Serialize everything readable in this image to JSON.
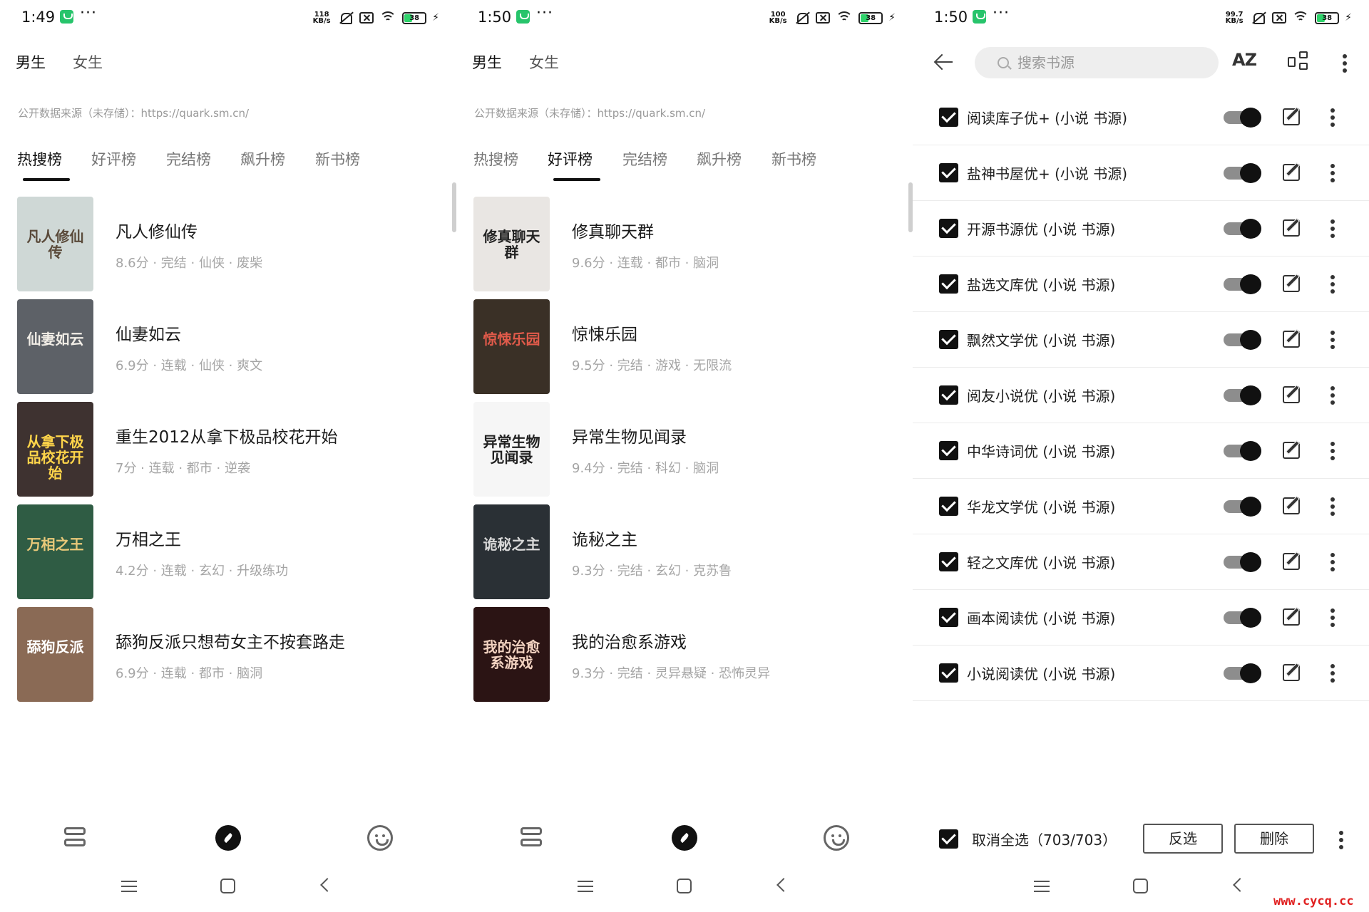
{
  "colors": {
    "accent": "#111111",
    "battery_fill": "#2fd36b",
    "app_badge": "#27c46b",
    "watermark": "#e02020"
  },
  "panels": [
    {
      "status": {
        "time": "1:49",
        "speed_top": "118",
        "speed_unit": "KB/s",
        "battery": "38",
        "battery_fraction": 0.38
      },
      "gender_tabs": [
        "男生",
        "女生"
      ],
      "source_note": "公开数据来源（未存储）：https://quark.sm.cn/",
      "rank_tabs": [
        "热搜榜",
        "好评榜",
        "完结榜",
        "飙升榜",
        "新书榜"
      ],
      "active_rank": 0,
      "books": [
        {
          "title": "凡人修仙传",
          "meta": "8.6分 · 完结 · 仙侠 · 废柴",
          "cover_text": "凡人修仙传",
          "cover_bg": "#cfd8d6",
          "cover_fg": "#5a4a3a"
        },
        {
          "title": "仙妻如云",
          "meta": "6.9分 · 连载 · 仙侠 · 爽文",
          "cover_text": "仙妻如云",
          "cover_bg": "#5d6167",
          "cover_fg": "#f1ede6"
        },
        {
          "title": "重生2012从拿下极品校花开始",
          "meta": "7分 · 连载 · 都市 · 逆袭",
          "cover_text": "从拿下极品校花开始",
          "cover_bg": "#3e3230",
          "cover_fg": "#ffd54a"
        },
        {
          "title": "万相之王",
          "meta": "4.2分 · 连载 · 玄幻 · 升级练功",
          "cover_text": "万相之王",
          "cover_bg": "#2f5c44",
          "cover_fg": "#e8c879"
        },
        {
          "title": "舔狗反派只想苟女主不按套路走",
          "meta": "6.9分 · 连载 · 都市 · 脑洞",
          "cover_text": "舔狗反派",
          "cover_bg": "#8a6a55",
          "cover_fg": "#ffffff"
        }
      ]
    },
    {
      "status": {
        "time": "1:50",
        "speed_top": "100",
        "speed_unit": "KB/s",
        "battery": "38",
        "battery_fraction": 0.38
      },
      "gender_tabs": [
        "男生",
        "女生"
      ],
      "source_note": "公开数据来源（未存储）：https://quark.sm.cn/",
      "rank_tabs": [
        "热搜榜",
        "好评榜",
        "完结榜",
        "飙升榜",
        "新书榜"
      ],
      "active_rank": 1,
      "books": [
        {
          "title": "修真聊天群",
          "meta": "9.6分 · 连载 · 都市 · 脑洞",
          "cover_text": "修真聊天群",
          "cover_bg": "#e9e6e3",
          "cover_fg": "#222222"
        },
        {
          "title": "惊悚乐园",
          "meta": "9.5分 · 完结 · 游戏 · 无限流",
          "cover_text": "惊悚乐园",
          "cover_bg": "#3a3026",
          "cover_fg": "#e05a4a"
        },
        {
          "title": "异常生物见闻录",
          "meta": "9.4分 · 完结 · 科幻 · 脑洞",
          "cover_text": "异常生物见闻录",
          "cover_bg": "#f6f6f6",
          "cover_fg": "#222222"
        },
        {
          "title": "诡秘之主",
          "meta": "9.3分 · 完结 · 玄幻 · 克苏鲁",
          "cover_text": "诡秘之主",
          "cover_bg": "#2a3035",
          "cover_fg": "#d8d8d8"
        },
        {
          "title": "我的治愈系游戏",
          "meta": "9.3分 · 完结 · 灵异悬疑 · 恐怖灵异",
          "cover_text": "我的治愈系游戏",
          "cover_bg": "#2b1414",
          "cover_fg": "#f2d2c0"
        }
      ]
    }
  ],
  "source_panel": {
    "status": {
      "time": "1:50",
      "speed_top": "99.7",
      "speed_unit": "KB/s",
      "battery": "38",
      "battery_fraction": 0.38
    },
    "search_placeholder": "搜索书源",
    "sort_label": "AZ",
    "sources": [
      "阅读库子优+ (小说 书源)",
      "盐神书屋优+ (小说 书源)",
      "开源书源优 (小说 书源)",
      "盐选文库优 (小说 书源)",
      "飘然文学优 (小说 书源)",
      "阅友小说优 (小说 书源)",
      "中华诗词优 (小说 书源)",
      "华龙文学优 (小说 书源)",
      "轻之文库优 (小说 书源)",
      "画本阅读优 (小说 书源)",
      "小说阅读优 (小说 书源)"
    ],
    "select_all_label": "取消全选（703/703）",
    "invert_label": "反选",
    "delete_label": "删除"
  },
  "watermark": "www.cycq.cc"
}
